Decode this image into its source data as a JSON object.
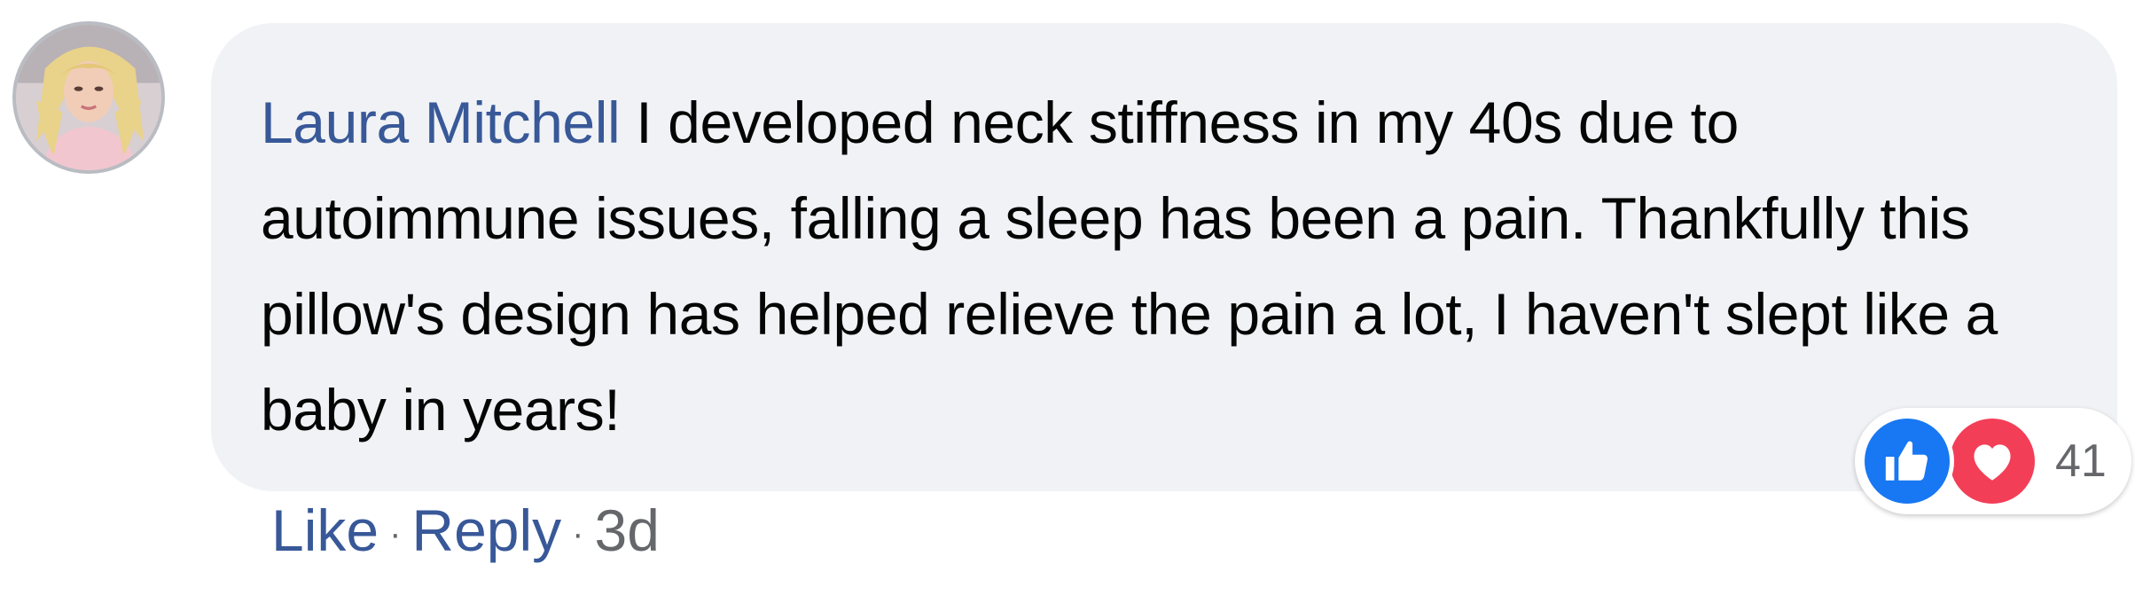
{
  "comment": {
    "author": "Laura Mitchell",
    "text": "I developed neck stiffness in my 40s due to autoimmune issues, falling a sleep has been a pain. Thankfully this pillow's design has helped relieve the pain a lot, I haven't slept like a baby in years!",
    "avatar_icon": "user-avatar-photo"
  },
  "reactions": {
    "icons": [
      "like-icon",
      "love-icon"
    ],
    "count": "41",
    "colors": {
      "like": "#1877f2",
      "love": "#f33e58"
    }
  },
  "actions": {
    "like_label": "Like",
    "reply_label": "Reply",
    "separator": "·",
    "timestamp": "3d"
  },
  "colors": {
    "author": "#385898",
    "bubble": "#f0f2f5",
    "text": "#050505",
    "meta": "#65676b"
  }
}
